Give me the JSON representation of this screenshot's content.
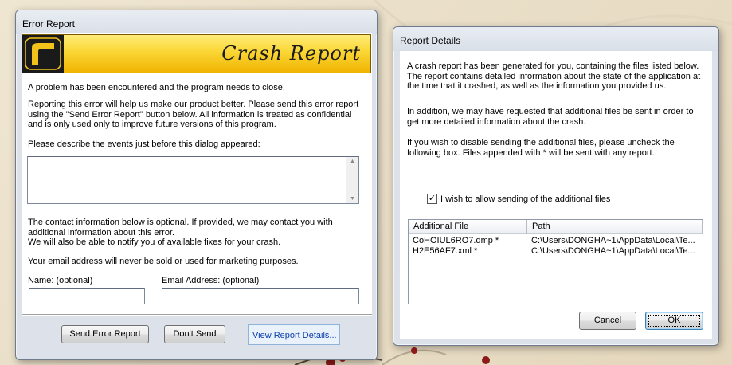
{
  "error_report": {
    "title": "Error Report",
    "banner_title": "Crash Report",
    "intro": "A problem has been encountered and the program needs to close.",
    "reporting_text": "Reporting this error will help us make our product better. Please send this error report\nusing the \"Send Error Report\" button below. All information is treated as confidential\nand is only used only to improve future versions of this program.",
    "describe_label": "Please describe the events just before this dialog appeared:",
    "description_value": "",
    "contact_text": "The contact information below is optional. If provided, we may contact you with\nadditional information about this error.\nWe will also be able to notify you of available fixes for your crash.",
    "privacy_text": "Your email address will never be sold or used for marketing purposes.",
    "name_label": "Name: (optional)",
    "name_value": "",
    "email_label": "Email Address: (optional)",
    "email_value": "",
    "send_button": "Send Error Report",
    "dont_send_button": "Don't Send",
    "view_details_link": "View Report Details..."
  },
  "report_details": {
    "title": "Report Details",
    "para1": "A crash report has been generated for you, containing the files listed below.\nThe report contains detailed information about the state of the application at\nthe time that it crashed, as well as the information you provided us.",
    "para2": "In addition, we may have requested that additional files be sent in order to\nget more detailed information about the crash.",
    "para3": "If you wish to disable sending the additional files, please uncheck the\nfollowing box.  Files appended with * will be sent with any report.",
    "checkbox_label": "I wish to allow sending of the additional files",
    "checkbox_checked": true,
    "columns": [
      "Additional File",
      "Path"
    ],
    "files": [
      {
        "name": "CoHOIUL6RO7.dmp *",
        "path": "C:\\Users\\DONGHA~1\\AppData\\Local\\Te..."
      },
      {
        "name": "H2E56AF7.xml *",
        "path": "C:\\Users\\DONGHA~1\\AppData\\Local\\Te..."
      }
    ],
    "cancel_button": "Cancel",
    "ok_button": "OK"
  }
}
